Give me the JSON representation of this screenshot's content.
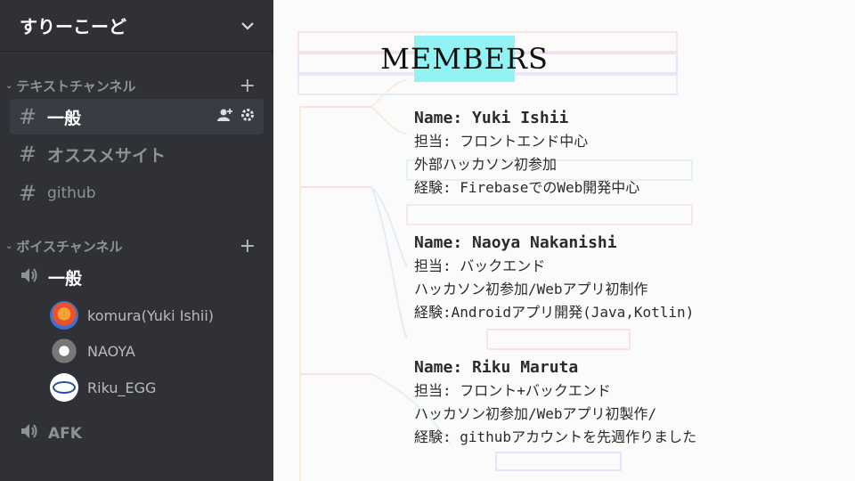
{
  "server": {
    "name": "すりーこーど"
  },
  "sidebar": {
    "text_category": "テキストチャンネル",
    "text_channels": [
      {
        "label": "一般"
      },
      {
        "label": "オススメサイト"
      },
      {
        "label": "github"
      }
    ],
    "voice_category": "ボイスチャンネル",
    "voice_channels": [
      {
        "label": "一般"
      },
      {
        "label": "AFK"
      }
    ],
    "voice_members": [
      {
        "name": "komura(Yuki Ishii)"
      },
      {
        "name": "NAOYA"
      },
      {
        "name": "Riku_EGG"
      }
    ]
  },
  "slide": {
    "title": "MEMBERS",
    "members": [
      {
        "name": "Name: Yuki Ishii",
        "lines": [
          "担当: フロントエンド中心",
          "外部ハッカソン初参加",
          "経験: FirebaseでのWeb開発中心"
        ]
      },
      {
        "name": "Name: Naoya Nakanishi",
        "lines": [
          "担当: バックエンド",
          "ハッカソン初参加/Webアプリ初制作",
          "経験:Androidアプリ開発(Java,Kotlin)"
        ]
      },
      {
        "name": "Name: Riku Maruta",
        "lines": [
          "担当: フロント+バックエンド",
          "ハッカソン初参加/Webアプリ初製作/",
          "経験: githubアカウントを先週作りました"
        ]
      }
    ]
  }
}
